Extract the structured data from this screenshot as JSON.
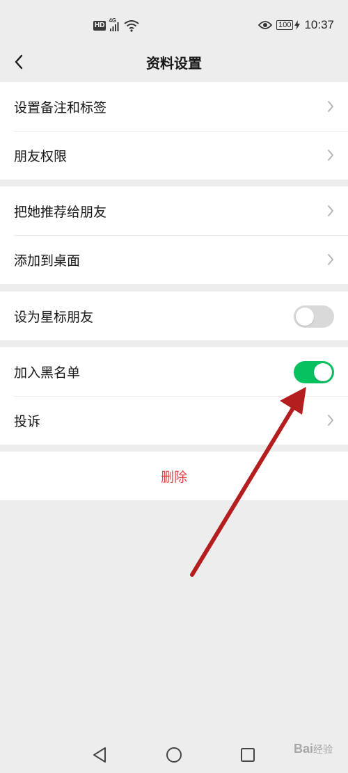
{
  "status_bar": {
    "hd": "HD",
    "network": "4G",
    "battery": "100",
    "time": "10:37"
  },
  "header": {
    "title": "资料设置"
  },
  "groups": [
    [
      {
        "label": "设置备注和标签",
        "control": "chevron"
      },
      {
        "label": "朋友权限",
        "control": "chevron"
      }
    ],
    [
      {
        "label": "把她推荐给朋友",
        "control": "chevron"
      },
      {
        "label": "添加到桌面",
        "control": "chevron"
      }
    ],
    [
      {
        "label": "设为星标朋友",
        "control": "toggle",
        "on": false
      }
    ],
    [
      {
        "label": "加入黑名单",
        "control": "toggle",
        "on": true
      },
      {
        "label": "投诉",
        "control": "chevron"
      }
    ]
  ],
  "delete": {
    "label": "删除"
  },
  "colors": {
    "toggle_on": "#07c160",
    "toggle_off": "#d9d9d9",
    "danger": "#e64340",
    "annotation_arrow": "#b51e1e"
  },
  "icons": [
    "back-arrow-icon",
    "chevron-right-icon",
    "back-triangle-icon",
    "home-circle-icon",
    "recents-square-icon"
  ],
  "watermark": {
    "brand": "Bai",
    "sub": "经验"
  }
}
